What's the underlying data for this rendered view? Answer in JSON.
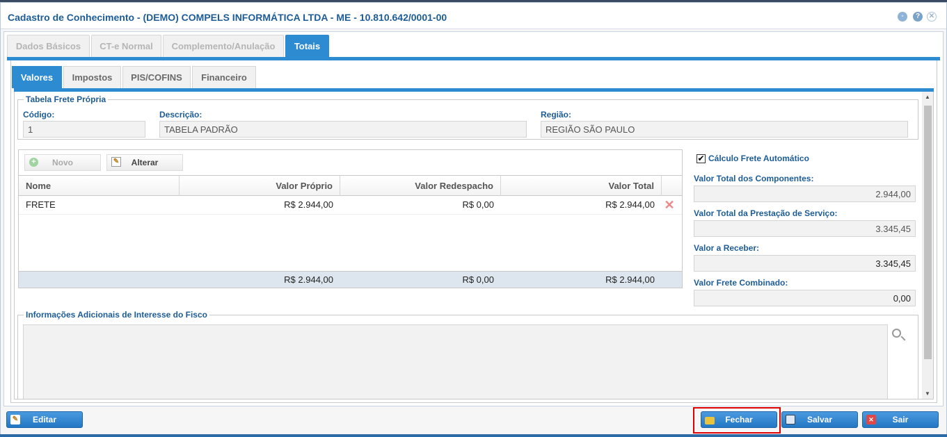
{
  "window": {
    "title": "Cadastro de Conhecimento - (DEMO) COMPELS INFORMÁTICA LTDA - ME - 10.810.642/0001-00"
  },
  "main_tabs": [
    {
      "label": "Dados Básicos"
    },
    {
      "label": "CT-e Normal"
    },
    {
      "label": "Complemento/Anulação"
    },
    {
      "label": "Totais"
    }
  ],
  "sub_tabs": [
    {
      "label": "Valores"
    },
    {
      "label": "Impostos"
    },
    {
      "label": "PIS/COFINS"
    },
    {
      "label": "Financeiro"
    }
  ],
  "tabela_frete": {
    "legend": "Tabela Frete Própria",
    "codigo_label": "Código:",
    "codigo_value": "1",
    "descricao_label": "Descrição:",
    "descricao_value": "TABELA PADRÃO",
    "regiao_label": "Região:",
    "regiao_value": "REGIÃO SÃO PAULO"
  },
  "grid": {
    "novo_label": "Novo",
    "alterar_label": "Alterar",
    "columns": [
      "Nome",
      "Valor Próprio",
      "Valor Redespacho",
      "Valor Total"
    ],
    "rows": [
      {
        "nome": "FRETE",
        "valor_proprio": "R$ 2.944,00",
        "valor_redespacho": "R$ 0,00",
        "valor_total": "R$ 2.944,00"
      }
    ],
    "totals": {
      "valor_proprio": "R$ 2.944,00",
      "valor_redespacho": "R$ 0,00",
      "valor_total": "R$ 2.944,00"
    }
  },
  "totais": {
    "calculo_auto_label": "Cálculo Frete Automático",
    "calculo_auto_checked": true,
    "componentes_label": "Valor Total dos Componentes:",
    "componentes_value": "2.944,00",
    "prestacao_label": "Valor Total da Prestação de Serviço:",
    "prestacao_value": "3.345,45",
    "receber_label": "Valor a Receber:",
    "receber_value": "3.345,45",
    "combinado_label": "Valor Frete Combinado:",
    "combinado_value": "0,00"
  },
  "info_adicionais": {
    "legend": "Informações Adicionais de Interesse do Fisco",
    "value": ""
  },
  "footer": {
    "editar_label": "Editar",
    "fechar_label": "Fechar",
    "salvar_label": "Salvar",
    "sair_label": "Sair"
  },
  "colors": {
    "accent": "#2d8bd1",
    "label": "#1d5c96",
    "highlight": "#e00000"
  }
}
